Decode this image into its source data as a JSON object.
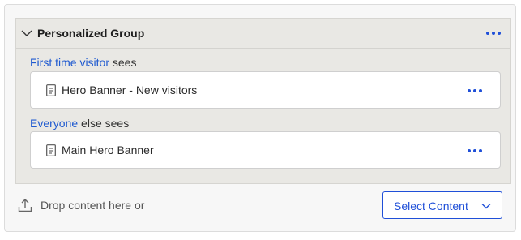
{
  "group": {
    "title": "Personalized Group",
    "chevron_icon": "chevron-down-icon",
    "menu_icon": "more-horizontal-icon"
  },
  "rules": [
    {
      "audience_link": "First time visitor",
      "suffix": " sees",
      "content": {
        "title": "Hero Banner - New visitors",
        "icon": "document-icon"
      }
    },
    {
      "audience_link": "Everyone",
      "suffix": " else sees",
      "content": {
        "title": "Main Hero Banner",
        "icon": "document-icon"
      }
    }
  ],
  "footer": {
    "upload_icon": "upload-icon",
    "drop_text": "Drop content here or",
    "select_button_label": "Select Content"
  },
  "colors": {
    "accent": "#1f4fd8",
    "group_bg": "#e9e8e4",
    "link": "#1f5ad0"
  }
}
